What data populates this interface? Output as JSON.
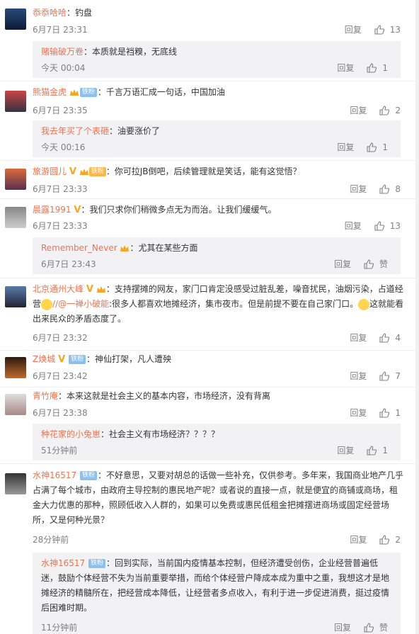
{
  "comments": [
    {
      "user": "忝忝哈哈",
      "text": "钓盘",
      "time": "6月7日 23:31",
      "reply_label": "回复",
      "likes": "13",
      "sub": {
        "user": "赌输破万卷",
        "text": "本质就是裆糗，无底线",
        "time": "今天 00:04",
        "reply_label": "回复",
        "likes": "1"
      }
    },
    {
      "user": "熊猫金虎",
      "badge": "铁粉",
      "text": "千言万语汇成一句话，中国加油",
      "time": "6月7日 23:35",
      "reply_label": "回复",
      "likes": "2",
      "sub": {
        "user": "我去年买了个表砸",
        "text": "油要涨价了",
        "time": "今天 00:16",
        "reply_label": "回复",
        "likes": "1"
      }
    },
    {
      "user": "旅游圆儿",
      "badge": "铁粉",
      "text": "你可拉JB倒吧，后续管理就是笑话，能有这觉悟？",
      "time": "6月7日 23:33",
      "reply_label": "回复",
      "likes": "8"
    },
    {
      "user": "晨露1991",
      "text": "我们只求你们稍微多点无为而治。让我们缓缓气。",
      "time": "6月7日 23:33",
      "reply_label": "回复",
      "likes": "13",
      "sub": {
        "user": "Remember_Never",
        "text": "尤其在某些方面",
        "time": "6月7日 23:43",
        "reply_label": "回复",
        "likes": "赞"
      }
    },
    {
      "user": "北京通州大峰",
      "text_a": "支持摆摊的网友，家门口肯定没感受过脏乱差，噪音扰民，油烟污染，占道经营",
      "mention": "//@一禅小破能",
      "text_b": ":很多人都喜欢地摊经济，集市夜市。但是前提不要在自己家门口。",
      "text_c": "这就能看出来民众的矛盾态度了。",
      "time": "6月7日 23:32",
      "reply_label": "回复",
      "likes": "4"
    },
    {
      "user": "Z焕城",
      "badge": "铁粉",
      "text": "神仙打架，凡人遭殃",
      "time": "6月7日 23:42",
      "reply_label": "回复",
      "likes": "7"
    },
    {
      "user": "青竹庵",
      "text": "本来这就是社会主义的基本内容，市场经济，没有背离",
      "time": "6月7日 23:38",
      "reply_label": "回复",
      "likes": "1",
      "sub": {
        "user": "种花家的小兔崽",
        "text": "社会主义有市场经济？？？？",
        "time": "51分钟前",
        "reply_label": "回复",
        "likes": "1"
      }
    },
    {
      "user": "水神16517",
      "badge": "铁粉",
      "text": "不好意思，又要对胡总的话做一些补充，仅供参考。多年来，我国商业地产几乎占满了每个城市，由政府主导控制的惠民地产呢？或者说的直接一点，就是便宜的商铺或商场，租金大力优惠的那种，照顾低收入人群的，如果可以免费或惠民低租金把摊摆进商场或固定经营场所，又是何种光景？",
      "time": "28分钟前",
      "reply_label": "回复",
      "likes": "2",
      "sub": {
        "user": "水神16517",
        "badge": "铁粉",
        "text": "回到实际，当前国内疫情基本控制，但经济遭受创伤，企业经营普遍低迷，鼓励个体经营不失为当前重要举措，而给个体经营户降成本成为重中之重，我想这才是地摊经济的精髓所在，把经营成本降低，让经营者多点收入，有利于进一步促进消费，挺过疫情后困难时期。",
        "time": "11分钟前",
        "reply_label": "回复",
        "likes": "赞"
      }
    }
  ]
}
